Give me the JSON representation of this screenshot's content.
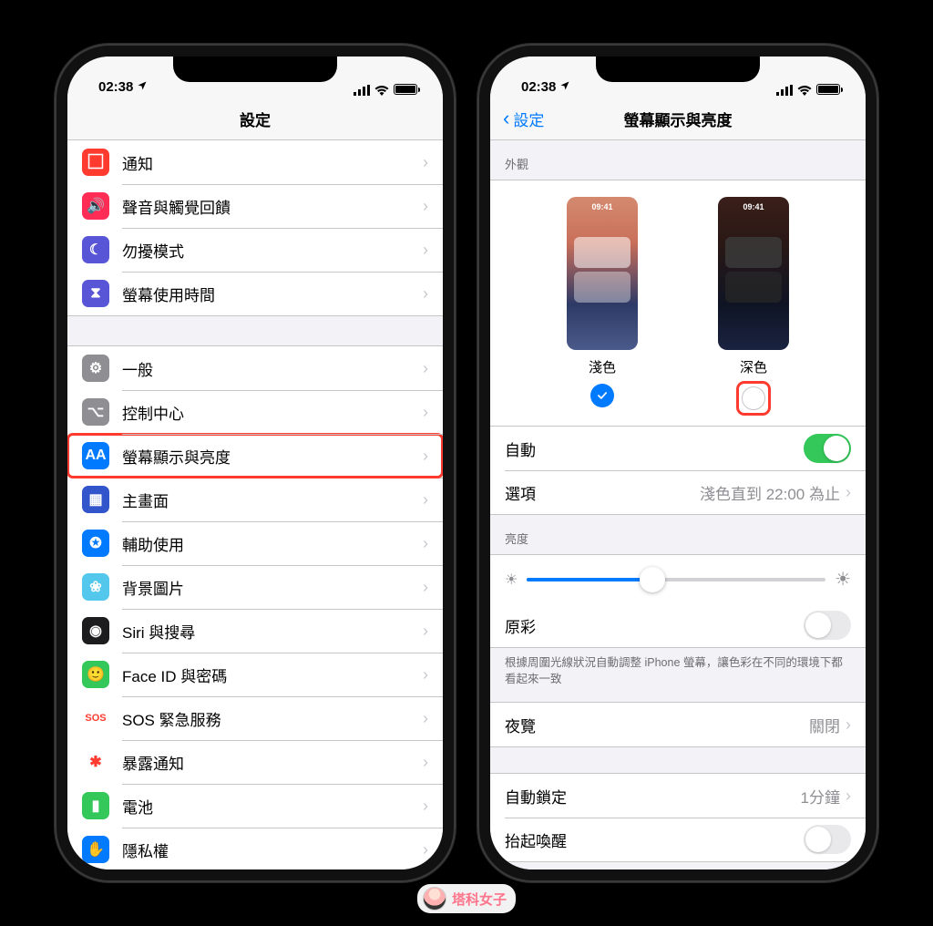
{
  "status": {
    "time": "02:38",
    "location": "◤"
  },
  "phone1": {
    "nav_title": "設定",
    "groups": [
      {
        "rows": [
          {
            "id": "notifications",
            "label": "通知",
            "icon_bg": "#ff3b30",
            "icon_glyph": "⬜︎"
          },
          {
            "id": "sounds",
            "label": "聲音與觸覺回饋",
            "icon_bg": "#ff2d55",
            "icon_glyph": "🔊"
          },
          {
            "id": "dnd",
            "label": "勿擾模式",
            "icon_bg": "#5856d6",
            "icon_glyph": "☾"
          },
          {
            "id": "screentime",
            "label": "螢幕使用時間",
            "icon_bg": "#5856d6",
            "icon_glyph": "⧗"
          }
        ]
      },
      {
        "rows": [
          {
            "id": "general",
            "label": "一般",
            "icon_bg": "#8e8e93",
            "icon_glyph": "⚙︎"
          },
          {
            "id": "control-center",
            "label": "控制中心",
            "icon_bg": "#8e8e93",
            "icon_glyph": "⌥"
          },
          {
            "id": "display",
            "label": "螢幕顯示與亮度",
            "icon_bg": "#007aff",
            "icon_glyph": "AA",
            "highlight": true
          },
          {
            "id": "home",
            "label": "主畫面",
            "icon_bg": "#3355cc",
            "icon_glyph": "▦"
          },
          {
            "id": "accessibility",
            "label": "輔助使用",
            "icon_bg": "#007aff",
            "icon_glyph": "✪"
          },
          {
            "id": "wallpaper",
            "label": "背景圖片",
            "icon_bg": "#54c7ec",
            "icon_glyph": "❀"
          },
          {
            "id": "siri",
            "label": "Siri 與搜尋",
            "icon_bg": "#1c1c1e",
            "icon_glyph": "◉"
          },
          {
            "id": "faceid",
            "label": "Face ID 與密碼",
            "icon_bg": "#34c759",
            "icon_glyph": "🙂"
          },
          {
            "id": "sos",
            "label": "SOS 緊急服務",
            "icon_bg": "#ffffff",
            "icon_glyph": "SOS",
            "text_color": "#ff3b30"
          },
          {
            "id": "exposure",
            "label": "暴露通知",
            "icon_bg": "#ffffff",
            "icon_glyph": "✱",
            "text_color": "#ff3b30"
          },
          {
            "id": "battery",
            "label": "電池",
            "icon_bg": "#34c759",
            "icon_glyph": "▮"
          },
          {
            "id": "privacy",
            "label": "隱私權",
            "icon_bg": "#007aff",
            "icon_glyph": "✋"
          }
        ]
      }
    ]
  },
  "phone2": {
    "back_label": "設定",
    "nav_title": "螢幕顯示與亮度",
    "section_appearance": "外觀",
    "appearance": {
      "light": {
        "label": "淺色",
        "preview_time": "09:41",
        "selected": true
      },
      "dark": {
        "label": "深色",
        "preview_time": "09:41",
        "selected": false,
        "highlight": true
      }
    },
    "auto_label": "自動",
    "auto_on": true,
    "options_label": "選項",
    "options_value": "淺色直到 22:00 為止",
    "section_brightness": "亮度",
    "brightness_percent": 42,
    "true_tone_label": "原彩",
    "true_tone_on": false,
    "true_tone_caption": "根據周圍光線狀況自動調整 iPhone 螢幕，讓色彩在不同的環境下都看起來一致",
    "night_shift_label": "夜覽",
    "night_shift_value": "關閉",
    "auto_lock_label": "自動鎖定",
    "auto_lock_value": "1分鐘",
    "raise_wake_label": "抬起喚醒",
    "raise_wake_on": false
  },
  "watermark": "塔科女子"
}
